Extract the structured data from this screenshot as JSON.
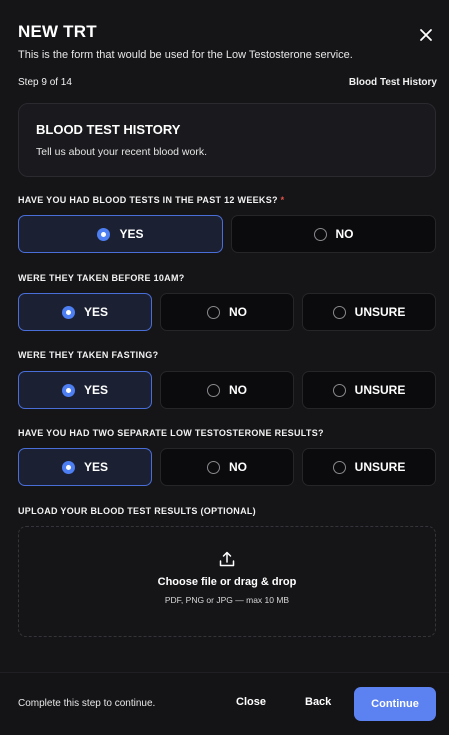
{
  "header": {
    "title": "NEW TRT",
    "subtitle": "This is the form that would be used for the Low Testosterone service."
  },
  "step": {
    "counter": "Step 9 of 14",
    "name": "Blood Test History"
  },
  "section": {
    "title": "BLOOD TEST HISTORY",
    "description": "Tell us about your recent blood work."
  },
  "questions": [
    {
      "label": "HAVE YOU HAD BLOOD TESTS IN THE PAST 12 WEEKS?",
      "required_mark": "*",
      "options": [
        "YES",
        "NO"
      ],
      "selected": "YES"
    },
    {
      "label": "WERE THEY TAKEN BEFORE 10AM?",
      "options": [
        "YES",
        "NO",
        "UNSURE"
      ],
      "selected": "YES"
    },
    {
      "label": "WERE THEY TAKEN FASTING?",
      "options": [
        "YES",
        "NO",
        "UNSURE"
      ],
      "selected": "YES"
    },
    {
      "label": "HAVE YOU HAD TWO SEPARATE LOW TESTOSTERONE RESULTS?",
      "options": [
        "YES",
        "NO",
        "UNSURE"
      ],
      "selected": "YES"
    }
  ],
  "upload": {
    "label": "UPLOAD YOUR BLOOD TEST RESULTS (OPTIONAL)",
    "main_text": "Choose file or drag & drop",
    "hint": "PDF, PNG or JPG — max 10 MB",
    "icon": "upload-icon"
  },
  "footer": {
    "hint": "Complete this step to continue.",
    "close_label": "Close",
    "back_label": "Back",
    "continue_label": "Continue"
  },
  "colors": {
    "accent": "#5b82f0",
    "selected_border": "#4a6ed8",
    "required": "#e5534b"
  }
}
